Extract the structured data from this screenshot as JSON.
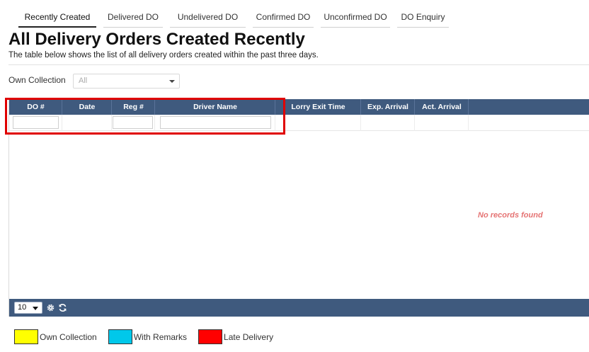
{
  "tabs": [
    {
      "label": "Recently Created",
      "active": true
    },
    {
      "label": "Delivered DO",
      "active": false
    },
    {
      "label": "Undelivered DO",
      "active": false
    },
    {
      "label": "Confirmed DO",
      "active": false
    },
    {
      "label": "Unconfirmed DO",
      "active": false
    },
    {
      "label": "DO Enquiry",
      "active": false
    }
  ],
  "page": {
    "title": "All Delivery Orders Created Recently",
    "subtitle": "The table below shows the list of all delivery orders created within the past three days."
  },
  "filter": {
    "label": "Own Collection",
    "value": "All"
  },
  "grid": {
    "columns": [
      "DO #",
      "Date",
      "Reg #",
      "Driver Name",
      "Lorry Exit Time",
      "Exp. Arrival",
      "Act. Arrival"
    ],
    "empty_message": "No records found",
    "page_size": "10"
  },
  "legend": [
    {
      "label": "Own Collection",
      "color": "#ffff00"
    },
    {
      "label": "With Remarks",
      "color": "#00c8ea"
    },
    {
      "label": "Late Delivery",
      "color": "#ff0000"
    }
  ],
  "colors": {
    "header": "#3f5a7e",
    "highlight": "#e00000",
    "empty_text": "#e57373"
  }
}
